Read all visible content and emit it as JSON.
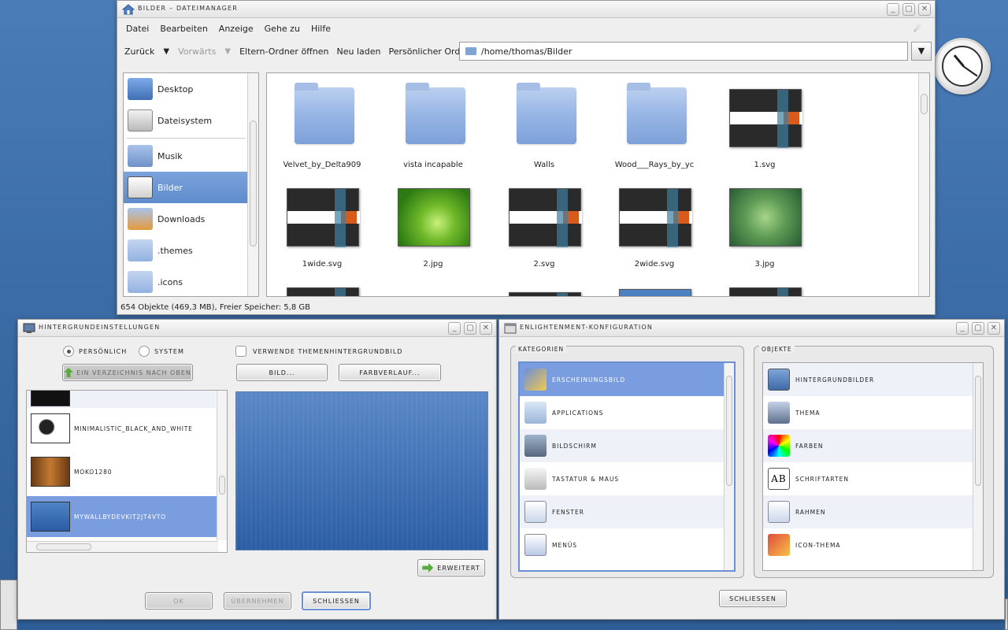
{
  "file_manager": {
    "title": "Bilder – Dateimanager",
    "menu": [
      "Datei",
      "Bearbeiten",
      "Anzeige",
      "Gehe zu",
      "Hilfe"
    ],
    "toolbar": {
      "back": "Zurück",
      "forward": "Vorwärts",
      "parent": "Eltern-Ordner öffnen",
      "reload": "Neu laden",
      "home": "Persönlicher Ordner"
    },
    "path": "/home/thomas/Bilder",
    "sidebar": [
      {
        "label": "Desktop",
        "icon": "desktop-icon"
      },
      {
        "label": "Dateisystem",
        "icon": "drive-icon"
      },
      {
        "label": "Musik",
        "icon": "music-folder-icon"
      },
      {
        "label": "Bilder",
        "icon": "pictures-folder-icon",
        "selected": true
      },
      {
        "label": "Downloads",
        "icon": "downloads-folder-icon"
      },
      {
        "label": ".themes",
        "icon": "folder-icon"
      },
      {
        "label": ".icons",
        "icon": "folder-icon"
      }
    ],
    "files": [
      {
        "name": "Velvet_by_Delta909",
        "kind": "folder"
      },
      {
        "name": "vista incapable",
        "kind": "folder"
      },
      {
        "name": "Walls",
        "kind": "folder"
      },
      {
        "name": "Wood___Rays_by_yc",
        "kind": "folder"
      },
      {
        "name": "1.svg",
        "kind": "dark"
      },
      {
        "name": "1wide.svg",
        "kind": "dark"
      },
      {
        "name": "2.jpg",
        "kind": "green"
      },
      {
        "name": "2.svg",
        "kind": "dark"
      },
      {
        "name": "2wide.svg",
        "kind": "dark"
      },
      {
        "name": "3.jpg",
        "kind": "leaf"
      }
    ],
    "status": "654 Objekte (469,3 MB), Freier Speicher: 5,8 GB"
  },
  "bg_settings": {
    "title": "Hintergrundeinstellungen",
    "radio_personal": "Persönlich",
    "radio_system": "System",
    "use_theme": "Verwende Themenhintergrundbild",
    "up_dir": "Ein Verzeichnis nach oben",
    "image_btn": "Bild...",
    "gradient_btn": "Farbverlauf...",
    "wallpapers": [
      {
        "label": "minimalistic_black_and_white"
      },
      {
        "label": "Moko1280"
      },
      {
        "label": "mywallbydevkit2jt4vto",
        "selected": true
      }
    ],
    "advanced_btn": "Erweitert",
    "ok_btn": "OK",
    "apply_btn": "Übernehmen",
    "close_btn": "Schließen"
  },
  "config": {
    "title": "Enlightenment-Konfiguration",
    "categories_label": "Kategorien",
    "objects_label": "Objekte",
    "categories": [
      {
        "label": "Erscheinungsbild",
        "selected": true
      },
      {
        "label": "Applications"
      },
      {
        "label": "Bildschirm"
      },
      {
        "label": "Tastatur & Maus"
      },
      {
        "label": "Fenster"
      },
      {
        "label": "Menüs"
      }
    ],
    "objects": [
      {
        "label": "Hintergrundbilder"
      },
      {
        "label": "Thema"
      },
      {
        "label": "Farben"
      },
      {
        "label": "Schriftarten"
      },
      {
        "label": "Rahmen"
      },
      {
        "label": "Icon-Thema"
      }
    ],
    "close_btn": "Schließen"
  }
}
